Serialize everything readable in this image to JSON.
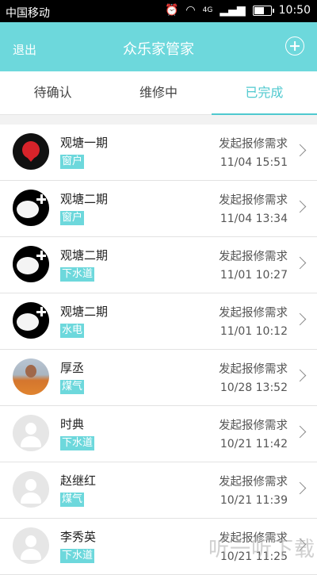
{
  "status_bar": {
    "carrier": "中国移动",
    "network": "4G",
    "time": "10:50",
    "battery_level": 0.65
  },
  "header": {
    "back_label": "退出",
    "title": "众乐家管家",
    "add_icon": "plus-circle-icon"
  },
  "tabs": [
    {
      "label": "待确认",
      "active": false
    },
    {
      "label": "维修中",
      "active": false
    },
    {
      "label": "已完成",
      "active": true
    }
  ],
  "colors": {
    "accent": "#6dd8dc",
    "active_tab": "#4fc9cf"
  },
  "records": [
    {
      "name": "观塘一期",
      "tag": "窗户",
      "action": "发起报修需求",
      "time": "11/04 15:51",
      "avatar": "red-badge-avatar"
    },
    {
      "name": "观塘二期",
      "tag": "窗户",
      "action": "发起报修需求",
      "time": "11/04 13:34",
      "avatar": "cloud-plus-avatar"
    },
    {
      "name": "观塘二期",
      "tag": "下水道",
      "action": "发起报修需求",
      "time": "11/01 10:27",
      "avatar": "cloud-plus-avatar"
    },
    {
      "name": "观塘二期",
      "tag": "水电",
      "action": "发起报修需求",
      "time": "11/01 10:12",
      "avatar": "cloud-plus-avatar"
    },
    {
      "name": "厚丞",
      "tag": "煤气",
      "action": "发起报修需求",
      "time": "10/28 13:52",
      "avatar": "photo-avatar"
    },
    {
      "name": "时典",
      "tag": "下水道",
      "action": "发起报修需求",
      "time": "10/21 11:42",
      "avatar": "default-avatar"
    },
    {
      "name": "赵继红",
      "tag": "煤气",
      "action": "发起报修需求",
      "time": "10/21 11:39",
      "avatar": "default-avatar"
    },
    {
      "name": "李秀英",
      "tag": "下水道",
      "action": "发起报修需求",
      "time": "10/21 11:25",
      "avatar": "default-avatar"
    }
  ],
  "watermark": "听一听下载"
}
